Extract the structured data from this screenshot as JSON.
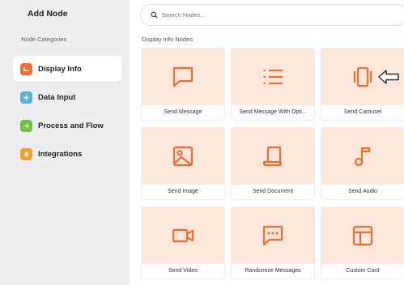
{
  "sidebar": {
    "title": "Add Node",
    "subtitle": "Node Categories",
    "categories": [
      {
        "label": "Display Info",
        "color": "#f26c2d",
        "icon": "message-icon"
      },
      {
        "label": "Data Input",
        "color": "#4fb6d9",
        "icon": "plus-icon"
      },
      {
        "label": "Process and Flow",
        "color": "#74c044",
        "icon": "arrow-icon"
      },
      {
        "label": "Integrations",
        "color": "#f7a21b",
        "icon": "puzzle-icon"
      }
    ]
  },
  "search": {
    "placeholder": "Search Nodes..."
  },
  "section": {
    "title": "Display Info Nodes"
  },
  "nodes": [
    {
      "label": "Send Message",
      "icon": "chat-bubble-icon"
    },
    {
      "label": "Send Message With Opti...",
      "icon": "list-icon"
    },
    {
      "label": "Send Carousel",
      "icon": "carousel-icon"
    },
    {
      "label": "Send Image",
      "icon": "image-icon"
    },
    {
      "label": "Send Document",
      "icon": "document-icon"
    },
    {
      "label": "Send Audio",
      "icon": "music-note-icon"
    },
    {
      "label": "Send Video",
      "icon": "video-camera-icon"
    },
    {
      "label": "Randomize Messages",
      "icon": "chat-dots-icon"
    },
    {
      "label": "Custom Card",
      "icon": "layout-card-icon"
    }
  ],
  "colors": {
    "accent": "#f26c2d",
    "card_bg": "#fce7dd"
  }
}
